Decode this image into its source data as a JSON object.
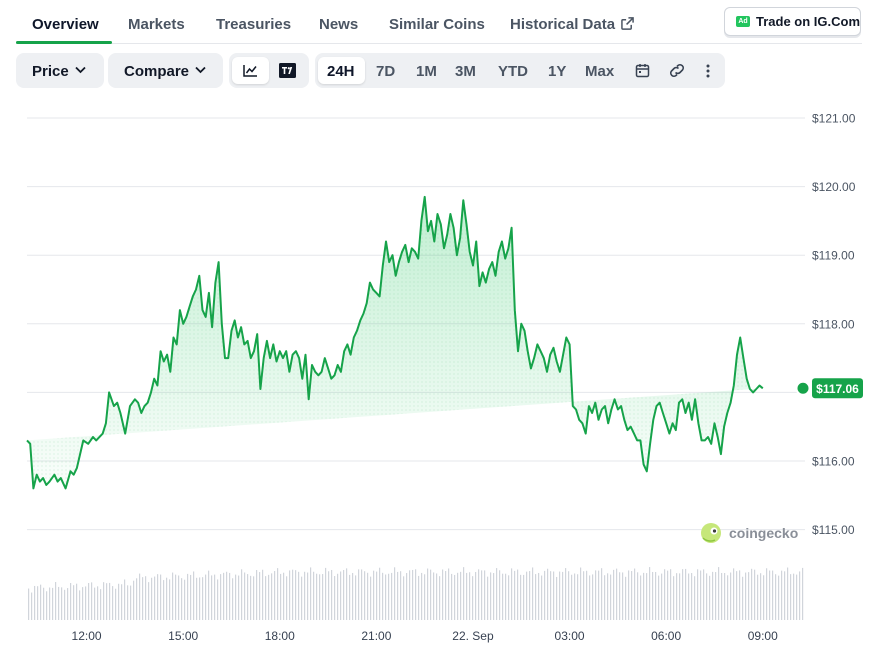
{
  "tabs": [
    {
      "label": "Overview"
    },
    {
      "label": "Markets"
    },
    {
      "label": "Treasuries"
    },
    {
      "label": "News"
    },
    {
      "label": "Similar Coins"
    },
    {
      "label": "Historical Data"
    }
  ],
  "ad_button": {
    "badge": "Ad",
    "label": "Trade on IG.Com"
  },
  "toolbar": {
    "price_label": "Price",
    "compare_label": "Compare",
    "ranges": [
      "24H",
      "7D",
      "1M",
      "3M",
      "YTD",
      "1Y",
      "Max"
    ],
    "selected_range": "24H"
  },
  "icons": {
    "line_chart": "line-chart-icon",
    "tradingview": "tradingview-icon",
    "calendar": "calendar-icon",
    "link": "link-icon",
    "more": "more-vertical-icon",
    "external": "external-link-icon",
    "watermark": "coingecko-logo-icon"
  },
  "watermark_text": "coingecko",
  "colors": {
    "accent": "#16a34a",
    "line": "#16a34a",
    "grid": "#e5e7eb"
  },
  "chart_data": {
    "type": "area",
    "ylim": [
      114.8,
      121.2
    ],
    "y_ticks": [
      121.0,
      120.0,
      119.0,
      118.0,
      117.0,
      116.0,
      115.0
    ],
    "y_tick_labels": [
      "$121.00",
      "$120.00",
      "$119.00",
      "$118.00",
      "$117.00",
      "$116.00",
      "$115.00"
    ],
    "x_tick_labels": [
      "12:00",
      "15:00",
      "18:00",
      "21:00",
      "22. Sep",
      "03:00",
      "06:00",
      "09:00"
    ],
    "x_tick_hours": [
      12,
      15,
      18,
      21,
      24,
      27,
      30,
      33
    ],
    "x_range_hours": [
      10.15,
      34.25
    ],
    "current_price": 117.06,
    "current_label": "$117.06",
    "x": [
      10.15,
      10.25,
      10.35,
      10.45,
      10.55,
      10.65,
      10.75,
      10.85,
      11.0,
      11.1,
      11.2,
      11.35,
      11.5,
      11.6,
      11.7,
      11.8,
      11.9,
      12.05,
      12.2,
      12.3,
      12.5,
      12.6,
      12.7,
      12.85,
      12.95,
      13.05,
      13.2,
      13.35,
      13.5,
      13.6,
      13.7,
      13.8,
      13.9,
      14.0,
      14.1,
      14.2,
      14.3,
      14.4,
      14.5,
      14.6,
      14.7,
      14.8,
      14.9,
      15.0,
      15.1,
      15.2,
      15.3,
      15.4,
      15.5,
      15.6,
      15.7,
      15.8,
      15.9,
      16.0,
      16.1,
      16.2,
      16.3,
      16.4,
      16.5,
      16.6,
      16.7,
      16.8,
      16.9,
      17.0,
      17.1,
      17.2,
      17.3,
      17.4,
      17.5,
      17.6,
      17.7,
      17.8,
      17.9,
      18.0,
      18.1,
      18.2,
      18.3,
      18.4,
      18.5,
      18.6,
      18.7,
      18.8,
      18.9,
      19.0,
      19.1,
      19.2,
      19.3,
      19.4,
      19.5,
      19.6,
      19.7,
      19.8,
      19.9,
      20.0,
      20.1,
      20.2,
      20.3,
      20.4,
      20.5,
      20.6,
      20.7,
      20.8,
      20.9,
      21.0,
      21.1,
      21.2,
      21.3,
      21.4,
      21.5,
      21.6,
      21.7,
      21.8,
      21.9,
      22.0,
      22.1,
      22.2,
      22.3,
      22.4,
      22.5,
      22.6,
      22.7,
      22.8,
      22.9,
      23.0,
      23.1,
      23.2,
      23.3,
      23.4,
      23.5,
      23.6,
      23.7,
      23.8,
      23.9,
      24.0,
      24.1,
      24.2,
      24.3,
      24.4,
      24.5,
      24.6,
      24.7,
      24.8,
      24.9,
      25.0,
      25.1,
      25.2,
      25.3,
      25.4,
      25.5,
      25.6,
      25.7,
      25.8,
      25.9,
      26.0,
      26.1,
      26.2,
      26.3,
      26.4,
      26.5,
      26.6,
      26.7,
      26.8,
      26.9,
      27.0,
      27.1,
      27.2,
      27.3,
      27.4,
      27.5,
      27.6,
      27.7,
      27.8,
      27.9,
      28.0,
      28.1,
      28.2,
      28.3,
      28.4,
      28.5,
      28.6,
      28.7,
      28.8,
      28.9,
      29.0,
      29.1,
      29.2,
      29.3,
      29.4,
      29.5,
      29.6,
      29.7,
      29.8,
      29.9,
      30.0,
      30.1,
      30.2,
      30.3,
      30.4,
      30.5,
      30.6,
      30.7,
      30.8,
      30.9,
      31.0,
      31.1,
      31.2,
      31.3,
      31.4,
      31.5,
      31.6,
      31.7,
      31.8,
      31.9,
      32.0,
      32.1,
      32.2,
      32.3,
      32.4,
      32.5,
      32.6,
      32.7,
      32.8,
      32.9,
      33.0,
      33.1,
      33.2,
      33.3,
      33.4,
      33.5,
      33.6,
      33.7,
      33.8,
      33.9,
      34.0,
      34.1,
      34.2,
      34.25
    ],
    "y": [
      116.3,
      116.25,
      115.6,
      115.8,
      115.7,
      115.75,
      115.65,
      115.7,
      115.8,
      115.7,
      115.75,
      115.6,
      115.85,
      115.8,
      115.9,
      116.1,
      116.3,
      116.25,
      116.35,
      116.3,
      116.4,
      116.55,
      117.0,
      116.8,
      116.85,
      116.7,
      116.4,
      116.8,
      116.9,
      116.85,
      116.7,
      116.8,
      116.85,
      117.0,
      117.2,
      117.1,
      117.6,
      117.45,
      117.55,
      117.3,
      117.8,
      117.7,
      118.2,
      118.0,
      118.1,
      118.25,
      118.4,
      118.5,
      118.7,
      118.2,
      118.1,
      118.45,
      117.95,
      118.6,
      118.9,
      118.0,
      117.5,
      117.5,
      117.9,
      118.05,
      117.8,
      117.95,
      117.7,
      117.75,
      117.5,
      117.6,
      117.85,
      117.05,
      117.5,
      117.75,
      117.5,
      117.7,
      117.45,
      117.6,
      117.5,
      117.6,
      117.3,
      117.55,
      117.6,
      117.5,
      117.2,
      117.55,
      116.9,
      117.4,
      117.3,
      117.25,
      117.3,
      117.5,
      117.35,
      117.2,
      117.25,
      117.4,
      117.3,
      117.6,
      117.7,
      117.55,
      117.8,
      117.9,
      118.05,
      118.15,
      118.3,
      118.6,
      118.5,
      118.45,
      118.4,
      118.85,
      119.2,
      118.9,
      119.0,
      118.7,
      118.9,
      119.05,
      119.15,
      118.9,
      119.1,
      119.05,
      118.95,
      119.5,
      119.85,
      119.35,
      119.5,
      119.2,
      119.6,
      119.45,
      119.1,
      119.3,
      119.6,
      119.4,
      119.0,
      119.25,
      119.8,
      119.45,
      119.05,
      118.85,
      119.2,
      118.55,
      118.75,
      118.6,
      118.8,
      118.9,
      118.7,
      119.05,
      119.2,
      118.95,
      119.1,
      119.4,
      118.2,
      117.6,
      118.0,
      117.9,
      117.6,
      117.35,
      117.5,
      117.7,
      117.6,
      117.5,
      117.3,
      117.55,
      117.65,
      117.45,
      117.3,
      117.55,
      117.8,
      117.7,
      116.8,
      116.75,
      116.6,
      116.55,
      116.4,
      116.8,
      116.7,
      116.85,
      116.6,
      116.75,
      116.8,
      116.55,
      116.75,
      116.9,
      116.75,
      116.8,
      116.6,
      116.45,
      116.5,
      116.4,
      116.3,
      116.3,
      115.95,
      115.85,
      116.25,
      116.6,
      116.8,
      116.85,
      116.7,
      116.55,
      116.4,
      116.55,
      116.45,
      116.85,
      116.9,
      116.7,
      116.85,
      116.6,
      116.9,
      116.55,
      116.3,
      116.3,
      116.35,
      116.25,
      116.55,
      116.35,
      116.1,
      116.5,
      116.7,
      116.85,
      117.1,
      117.55,
      117.8,
      117.5,
      117.2,
      117.05,
      117.0,
      117.05,
      117.1,
      117.06
    ],
    "volume_note": "volume bars without axis"
  }
}
